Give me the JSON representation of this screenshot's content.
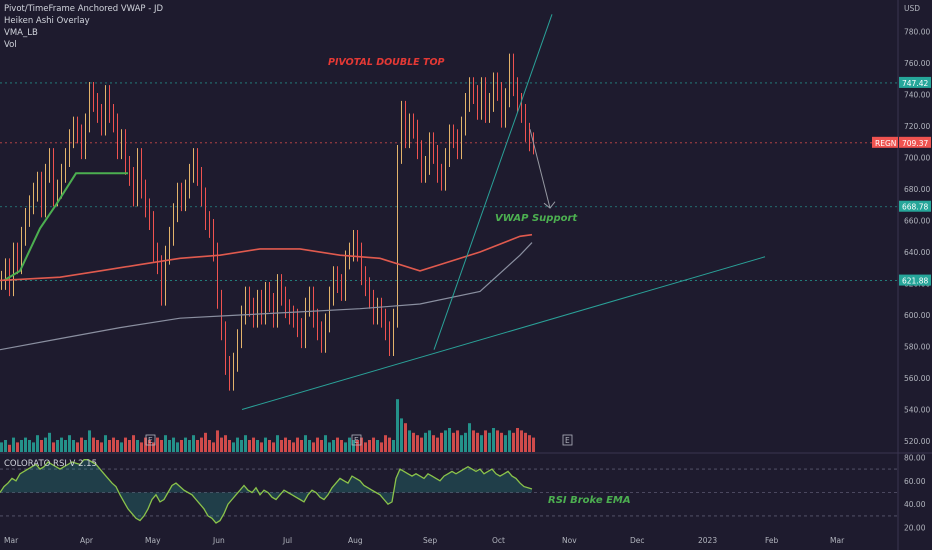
{
  "legend": {
    "line1": "Pivot/TimeFrame Anchored VWAP - JD",
    "line2": "Heiken Ashi Overlay",
    "line3": "VMA_LB",
    "line4": "Vol"
  },
  "rsi_title": "COLORATO RSI V 2.15",
  "annotations": {
    "double_top": "PIVOTAL DOUBLE TOP",
    "vwap_support": "VWAP Support",
    "rsi_broke": "RSI Broke EMA",
    "earnings_marker": "E"
  },
  "colors": {
    "bg": "#1e1b2e",
    "up": "#26a69a",
    "down": "#ef5350",
    "candle_up": "#e3b36b",
    "candle_down": "#ef5350",
    "accent_green": "#26a69a",
    "accent_red": "#e05a4e",
    "vma": "#4caf50"
  },
  "price_scale_currency": "USD",
  "price_labels": [
    {
      "value": "747.42",
      "color": "#26a69a"
    },
    {
      "value": "REGN",
      "color": "#ef5350"
    },
    {
      "value": "709.37",
      "color": "#ef5350"
    },
    {
      "value": "668.78",
      "color": "#26a69a"
    },
    {
      "value": "621.88",
      "color": "#26a69a"
    }
  ],
  "chart_data": {
    "type": "line",
    "symbol": "REGN",
    "price_axis": {
      "range": [
        513,
        795
      ],
      "ticks": [
        "780.00",
        "760.00",
        "740.00",
        "720.00",
        "700.00",
        "680.00",
        "660.00",
        "640.00",
        "620.00",
        "600.00",
        "580.00",
        "560.00",
        "540.00",
        "520.00"
      ]
    },
    "rsi_axis": {
      "range": [
        18,
        82
      ],
      "ticks": [
        "80.00",
        "60.00",
        "40.00",
        "20.00"
      ]
    },
    "time_axis": [
      "Mar",
      "Apr",
      "May",
      "Jun",
      "Jul",
      "Aug",
      "Sep",
      "Oct",
      "Nov",
      "Dec",
      "2023",
      "Feb",
      "Mar"
    ],
    "horizontal_levels": [
      747.42,
      709.37,
      668.78,
      621.88
    ],
    "price_series": {
      "name": "REGN",
      "x": [
        0,
        4,
        8,
        12,
        16,
        20,
        24,
        28,
        32,
        36,
        40,
        44,
        48,
        52,
        56,
        60,
        64,
        68,
        72,
        76,
        80,
        84,
        88,
        92,
        96,
        100,
        104,
        108,
        112,
        116,
        120,
        124,
        128,
        132,
        136,
        140,
        144,
        148,
        152,
        156,
        160,
        164,
        168,
        172,
        176,
        180,
        184,
        188,
        192,
        196,
        200,
        204,
        208,
        212,
        216,
        220,
        224,
        228,
        232,
        236,
        240,
        244,
        248,
        252,
        256,
        260,
        264,
        268,
        272,
        276,
        280,
        284,
        288,
        292,
        296,
        300,
        304,
        308,
        312,
        316,
        320,
        324,
        328,
        332,
        336,
        340,
        344,
        348,
        352,
        356,
        360,
        364,
        368,
        372,
        376,
        380,
        384,
        388,
        392,
        396,
        400,
        404,
        408,
        412,
        416,
        420,
        424,
        428,
        432,
        436,
        440,
        444,
        448,
        452,
        456,
        460,
        464,
        468,
        472,
        476,
        480,
        484,
        488,
        492,
        496,
        500,
        504,
        508,
        512,
        516,
        520,
        524,
        528,
        532
      ],
      "values": [
        622,
        630,
        618,
        640,
        632,
        650,
        662,
        670,
        678,
        685,
        668,
        690,
        700,
        675,
        680,
        690,
        700,
        712,
        720,
        715,
        705,
        722,
        742,
        735,
        728,
        720,
        740,
        728,
        722,
        705,
        712,
        695,
        688,
        675,
        700,
        680,
        668,
        660,
        640,
        632,
        612,
        638,
        650,
        665,
        678,
        672,
        680,
        690,
        700,
        688,
        675,
        660,
        655,
        640,
        610,
        590,
        568,
        558,
        570,
        585,
        600,
        612,
        605,
        598,
        610,
        600,
        615,
        608,
        598,
        620,
        612,
        604,
        600,
        598,
        592,
        585,
        605,
        612,
        598,
        590,
        582,
        595,
        612,
        625,
        620,
        615,
        635,
        640,
        648,
        640,
        625,
        618,
        610,
        600,
        605,
        598,
        590,
        580,
        598,
        702,
        730,
        712,
        722,
        718,
        705,
        690,
        695,
        710,
        702,
        690,
        685,
        700,
        715,
        712,
        705,
        720,
        735,
        745,
        740,
        730,
        745,
        728,
        735,
        748,
        742,
        725,
        738,
        760,
        745,
        735,
        728,
        716,
        710,
        708
      ]
    },
    "overlays": [
      {
        "name": "Heiken Ashi VMA (green)",
        "x": [
          4,
          20,
          40,
          56,
          76,
          100,
          120,
          128
        ],
        "values": [
          622,
          628,
          655,
          670,
          690,
          690,
          690,
          690
        ]
      },
      {
        "name": "Anchored VWAP (red)",
        "x": [
          0,
          60,
          100,
          140,
          180,
          220,
          260,
          300,
          340,
          380,
          420,
          440,
          480,
          520,
          532
        ],
        "values": [
          622,
          624,
          628,
          632,
          636,
          638,
          642,
          642,
          638,
          636,
          628,
          632,
          640,
          650,
          651
        ]
      },
      {
        "name": "Long VWAP (gray)",
        "x": [
          0,
          60,
          120,
          180,
          240,
          300,
          360,
          420,
          480,
          520,
          532
        ],
        "values": [
          578,
          585,
          592,
          598,
          600,
          602,
          604,
          607,
          615,
          638,
          646
        ]
      }
    ],
    "volume": {
      "name": "Vol",
      "values": [
        4,
        5,
        3,
        6,
        4,
        5,
        6,
        5,
        4,
        7,
        5,
        6,
        8,
        4,
        5,
        6,
        5,
        7,
        5,
        4,
        6,
        5,
        9,
        6,
        5,
        4,
        7,
        5,
        6,
        5,
        4,
        6,
        5,
        7,
        5,
        4,
        6,
        5,
        4,
        6,
        5,
        7,
        5,
        6,
        4,
        5,
        6,
        5,
        7,
        5,
        6,
        8,
        5,
        4,
        9,
        6,
        7,
        5,
        4,
        6,
        5,
        7,
        5,
        6,
        5,
        4,
        6,
        5,
        4,
        7,
        5,
        6,
        5,
        4,
        6,
        5,
        7,
        5,
        4,
        6,
        5,
        7,
        4,
        5,
        6,
        5,
        4,
        6,
        5,
        5,
        6,
        4,
        5,
        6,
        5,
        4,
        7,
        6,
        5,
        22,
        14,
        12,
        9,
        8,
        7,
        6,
        8,
        9,
        7,
        6,
        8,
        9,
        10,
        8,
        9,
        7,
        8,
        12,
        9,
        8,
        7,
        9,
        8,
        10,
        9,
        8,
        7,
        9,
        8,
        10,
        9,
        8,
        7,
        6
      ]
    },
    "rsi": {
      "name": "COLORATO RSI V 2.15",
      "values": [
        50,
        55,
        58,
        62,
        60,
        66,
        68,
        70,
        72,
        74,
        70,
        72,
        76,
        74,
        72,
        70,
        72,
        74,
        76,
        75,
        74,
        78,
        78,
        76,
        74,
        70,
        66,
        62,
        58,
        55,
        48,
        42,
        36,
        32,
        28,
        26,
        30,
        36,
        44,
        48,
        42,
        44,
        50,
        56,
        58,
        55,
        52,
        50,
        48,
        44,
        40,
        36,
        30,
        28,
        24,
        26,
        32,
        40,
        44,
        48,
        52,
        56,
        52,
        50,
        54,
        48,
        52,
        50,
        46,
        44,
        48,
        52,
        50,
        48,
        46,
        44,
        42,
        48,
        52,
        50,
        46,
        44,
        48,
        54,
        58,
        62,
        60,
        58,
        64,
        62,
        60,
        56,
        54,
        52,
        50,
        48,
        44,
        40,
        42,
        62,
        70,
        68,
        66,
        64,
        66,
        64,
        62,
        66,
        64,
        62,
        60,
        64,
        66,
        68,
        66,
        68,
        70,
        72,
        70,
        68,
        70,
        66,
        68,
        70,
        66,
        64,
        66,
        68,
        64,
        62,
        58,
        55,
        54,
        53
      ]
    }
  }
}
